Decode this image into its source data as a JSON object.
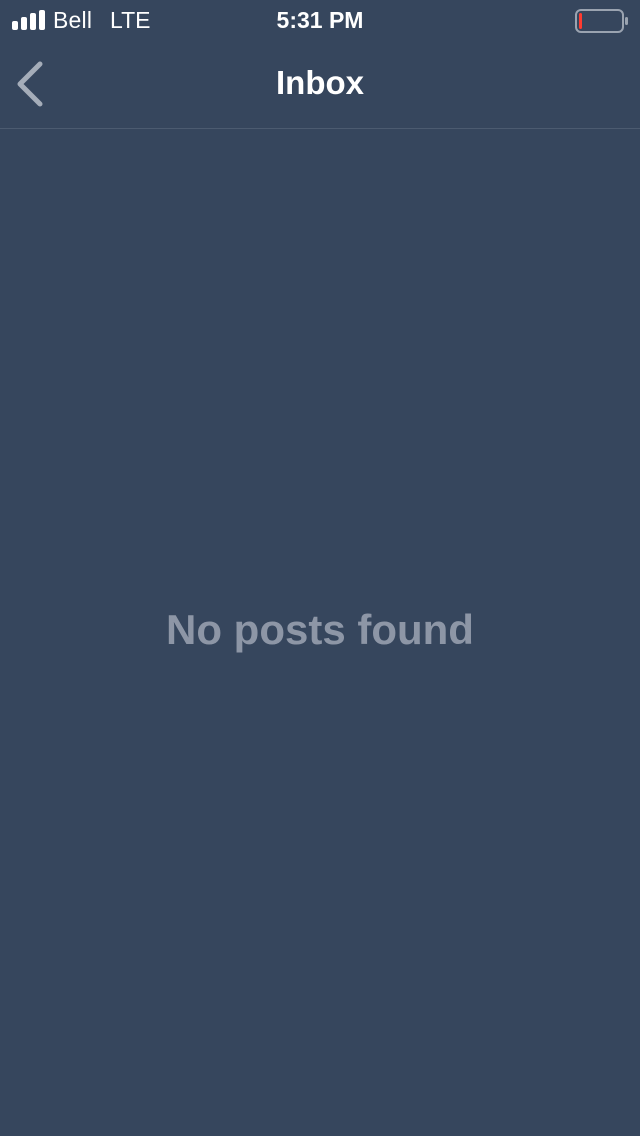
{
  "status_bar": {
    "carrier": "Bell",
    "network": "LTE",
    "time": "5:31 PM",
    "signal_icon": "cellular-signal-icon",
    "battery_icon": "battery-low-icon",
    "battery_level_fraction": 0.08,
    "battery_level_color": "#ff3b30"
  },
  "nav": {
    "title": "Inbox",
    "back_icon": "chevron-left-icon"
  },
  "main": {
    "empty_message": "No posts found"
  },
  "colors": {
    "background": "#36465d",
    "title_text": "#ffffff",
    "empty_text": "#8d96a6",
    "divider": "#4c5b70"
  }
}
